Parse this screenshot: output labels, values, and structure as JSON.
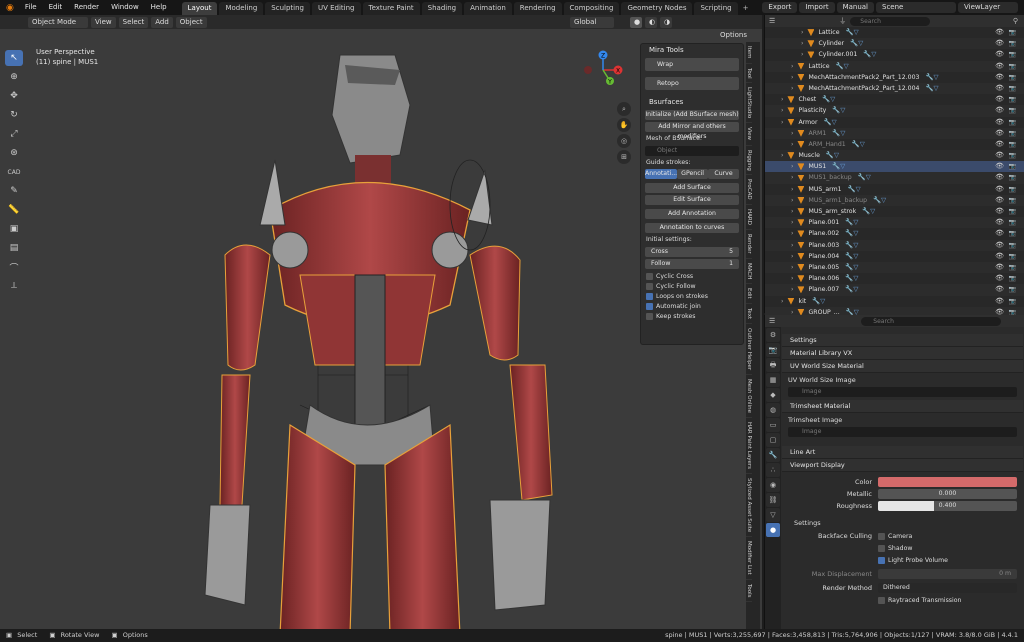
{
  "topbar": {
    "menus": [
      "File",
      "Edit",
      "Render",
      "Window",
      "Help"
    ],
    "workspaces": [
      "Layout",
      "Modeling",
      "Sculpting",
      "UV Editing",
      "Texture Paint",
      "Shading",
      "Animation",
      "Rendering",
      "Compositing",
      "Geometry Nodes",
      "Scripting"
    ],
    "active_workspace": "Layout",
    "export": "Export",
    "import": "Import",
    "manual": "Manual",
    "scene": "Scene",
    "view_layer": "ViewLayer"
  },
  "viewport": {
    "mode": "Object Mode",
    "menu": [
      "View",
      "Select",
      "Add",
      "Object"
    ],
    "transform": "Global",
    "perspective": "User Perspective",
    "object_info": "(11) spine | MUS1",
    "options": "Options",
    "axis": {
      "x": "X",
      "y": "Y",
      "z": "Z"
    },
    "tool_icons": [
      "cursor-icon",
      "cursor3d-icon",
      "move-icon",
      "rotate-icon",
      "scale-icon",
      "transform-icon",
      "cad-icon",
      "annotate-icon",
      "measure-icon",
      "add-cube-icon",
      "box-icon",
      "curve-icon",
      "gizmo-icon"
    ]
  },
  "mira": {
    "title": "Mira Tools",
    "wrap": "Wrap",
    "retopo": "Retopo",
    "bsurfaces": "Bsurfaces",
    "initialize": "Initialize (Add BSurface mesh)",
    "add_mirror": "Add Mirror and others modifiers",
    "mesh_label": "Mesh of BSurface:",
    "object_placeholder": "Object",
    "guide_label": "Guide strokes:",
    "guide_tabs": [
      "Annotati...",
      "GPencil",
      "Curve"
    ],
    "add_surface": "Add Surface",
    "edit_surface": "Edit Surface",
    "add_annotation": "Add Annotation",
    "annotation_to_curves": "Annotation to curves",
    "initial_settings": "Initial settings:",
    "cross_label": "Cross",
    "cross_value": "5",
    "follow_label": "Follow",
    "follow_value": "1",
    "checks": [
      {
        "label": "Cyclic Cross",
        "on": false
      },
      {
        "label": "Cyclic Follow",
        "on": false
      },
      {
        "label": "Loops on strokes",
        "on": true
      },
      {
        "label": "Automatic join",
        "on": true
      },
      {
        "label": "Keep strokes",
        "on": false
      }
    ]
  },
  "ntabs": [
    "Item",
    "Tool",
    "LightStudio",
    "View",
    "Rigging",
    "ProCAD",
    "HARD",
    "Render",
    "MACH",
    "Edit",
    "Text",
    "Outliner Helper",
    "Mesh Online",
    "HAR Paint Layers",
    "Stylized Asset Suite",
    "Modifier List",
    "Tools"
  ],
  "outliner": {
    "search_placeholder": "Search",
    "rows": [
      {
        "label": "Lattice",
        "indent": 3,
        "dim": false
      },
      {
        "label": "Cylinder",
        "indent": 3
      },
      {
        "label": "Cylinder.001",
        "indent": 3
      },
      {
        "label": "Lattice",
        "indent": 2
      },
      {
        "label": "MechAttachmentPack2_Part_12.003",
        "indent": 2
      },
      {
        "label": "MechAttachmentPack2_Part_12.004",
        "indent": 2
      },
      {
        "label": "Chest",
        "indent": 1
      },
      {
        "label": "Plasticity",
        "indent": 1
      },
      {
        "label": "Armor",
        "indent": 1
      },
      {
        "label": "ARM1",
        "indent": 2,
        "dim": true
      },
      {
        "label": "ARM_Hand1",
        "indent": 2,
        "dim": true
      },
      {
        "label": "Muscle",
        "indent": 1
      },
      {
        "label": "MUS1",
        "indent": 2,
        "hl": true
      },
      {
        "label": "MUS1_backup",
        "indent": 2,
        "dim": true
      },
      {
        "label": "MUS_arm1",
        "indent": 2
      },
      {
        "label": "MUS_arm1_backup",
        "indent": 2,
        "dim": true
      },
      {
        "label": "MUS_arm_strok",
        "indent": 2
      },
      {
        "label": "Plane.001",
        "indent": 2
      },
      {
        "label": "Plane.002",
        "indent": 2
      },
      {
        "label": "Plane.003",
        "indent": 2
      },
      {
        "label": "Plane.004",
        "indent": 2
      },
      {
        "label": "Plane.005",
        "indent": 2
      },
      {
        "label": "Plane.006",
        "indent": 2
      },
      {
        "label": "Plane.007",
        "indent": 2
      },
      {
        "label": "kit",
        "indent": 1
      },
      {
        "label": "GROUP_...",
        "indent": 2
      }
    ]
  },
  "properties": {
    "search_placeholder": "Search",
    "settings": "Settings",
    "material_library": "Material Library VX",
    "uv_world_size": "UV World Size Material",
    "uv_world_size_image": "UV World Size Image",
    "image_placeholder": "Image",
    "trimsheet": "Trimsheet Material",
    "trimsheet_image": "Trimsheet Image",
    "line_art": "Line Art",
    "viewport_display": "Viewport Display",
    "color_label": "Color",
    "color_value": "#d46a6a",
    "metallic_label": "Metallic",
    "metallic_value": "0.000",
    "roughness_label": "Roughness",
    "roughness_value": "0.400",
    "roughness_fill": 0.4,
    "settings2": "Settings",
    "backface_label": "Backface Culling",
    "camera": "Camera",
    "shadow": "Shadow",
    "light_probe": "Light Probe Volume",
    "max_displacement": "Max Displacement",
    "max_displacement_value": "0 m",
    "render_method_label": "Render Method",
    "render_method_value": "Dithered",
    "raytraced": "Raytraced Transmission"
  },
  "status": {
    "select": "Select",
    "rotate": "Rotate View",
    "options": "Options",
    "stats": "spine | MUS1 | Verts:3,255,697 | Faces:3,458,813 | Tris:5,764,906 | Objects:1/127 | VRAM: 3.8/8.0 GiB | 4.4.1"
  }
}
